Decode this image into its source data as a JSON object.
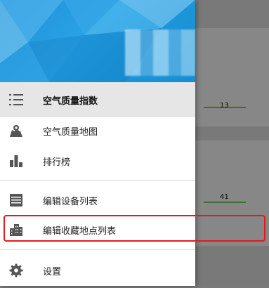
{
  "background": {
    "value1": "13",
    "value2": "41"
  },
  "drawer": {
    "items": [
      {
        "label": "空气质量指数",
        "icon": "list-icon",
        "selected": true
      },
      {
        "label": "空气质量地图",
        "icon": "map-icon",
        "selected": false
      },
      {
        "label": "排行榜",
        "icon": "bar-chart-icon",
        "selected": false
      },
      {
        "label": "编辑设备列表",
        "icon": "device-list-icon",
        "selected": false
      },
      {
        "label": "编辑收藏地点列表",
        "icon": "city-buildings-icon",
        "selected": false
      },
      {
        "label": "设置",
        "icon": "gear-icon",
        "selected": false
      }
    ]
  },
  "colors": {
    "header_blue": "#1f8fd6",
    "highlight_red": "#e21b1b",
    "selected_bg": "#e6e6e6"
  }
}
